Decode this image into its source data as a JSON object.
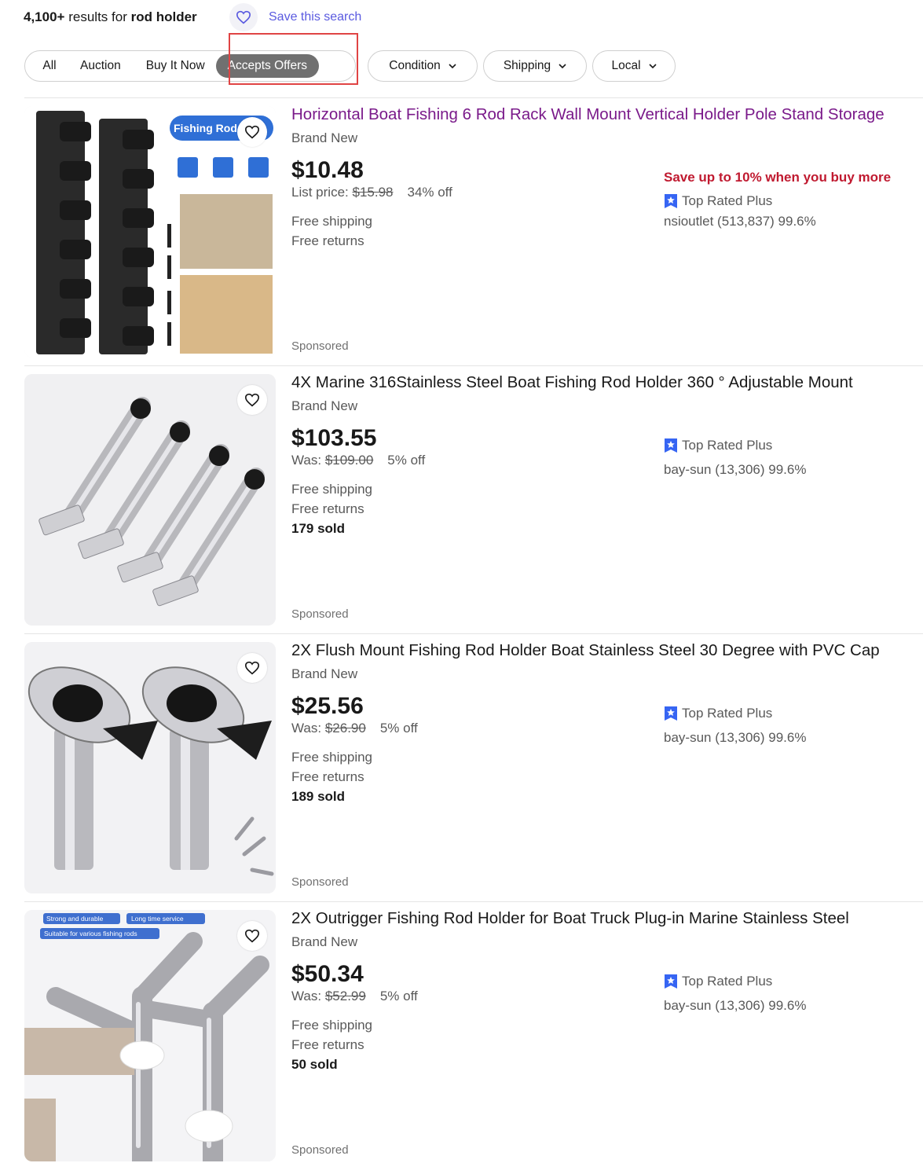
{
  "header": {
    "count": "4,100+",
    "results_for": "results for",
    "query": "rod holder",
    "save_search": "Save this search"
  },
  "filters": {
    "segments": [
      "All",
      "Auction",
      "Buy It Now",
      "Accepts Offers"
    ],
    "active_segment": "Accepts Offers",
    "dropdowns": [
      "Condition",
      "Shipping",
      "Local"
    ]
  },
  "listings": [
    {
      "title": "Horizontal Boat Fishing 6 Rod Rack Wall Mount Vertical Holder Pole Stand Storage",
      "condition": "Brand New",
      "price": "$10.48",
      "was_label": "List price:",
      "was_price": "$15.98",
      "discount": "34% off",
      "shipping": "Free shipping",
      "returns": "Free returns",
      "sold": "",
      "promo": "Save up to 10% when you buy more",
      "badge": "Top Rated Plus",
      "seller": "nsioutlet (513,837) 99.6%",
      "sponsored": "Sponsored",
      "image_text": "Fishing Rod"
    },
    {
      "title": "4X Marine 316Stainless Steel Boat Fishing Rod Holder 360 ° Adjustable Mount",
      "condition": "Brand New",
      "price": "$103.55",
      "was_label": "Was:",
      "was_price": "$109.00",
      "discount": "5% off",
      "shipping": "Free shipping",
      "returns": "Free returns",
      "sold": "179 sold",
      "promo": "",
      "badge": "Top Rated Plus",
      "seller": "bay-sun (13,306) 99.6%",
      "sponsored": "Sponsored"
    },
    {
      "title": "2X Flush Mount Fishing Rod Holder Boat Stainless Steel 30 Degree with PVC Cap",
      "condition": "Brand New",
      "price": "$25.56",
      "was_label": "Was:",
      "was_price": "$26.90",
      "discount": "5% off",
      "shipping": "Free shipping",
      "returns": "Free returns",
      "sold": "189 sold",
      "promo": "",
      "badge": "Top Rated Plus",
      "seller": "bay-sun (13,306) 99.6%",
      "sponsored": "Sponsored"
    },
    {
      "title": "2X Outrigger Fishing Rod Holder for Boat Truck Plug-in Marine Stainless Steel",
      "condition": "Brand New",
      "price": "$50.34",
      "was_label": "Was:",
      "was_price": "$52.99",
      "discount": "5% off",
      "shipping": "Free shipping",
      "returns": "Free returns",
      "sold": "50 sold",
      "promo": "",
      "badge": "Top Rated Plus",
      "seller": "bay-sun (13,306) 99.6%",
      "sponsored": "Sponsored",
      "image_tags": [
        "Strong and durable",
        "Long time service",
        "Suitable for various fishing rods"
      ]
    }
  ],
  "colors": {
    "visited_title": "#7a1a8a",
    "promo_red": "#c01a30",
    "badge_blue": "#3665f3",
    "highlight_red": "#e04444"
  }
}
